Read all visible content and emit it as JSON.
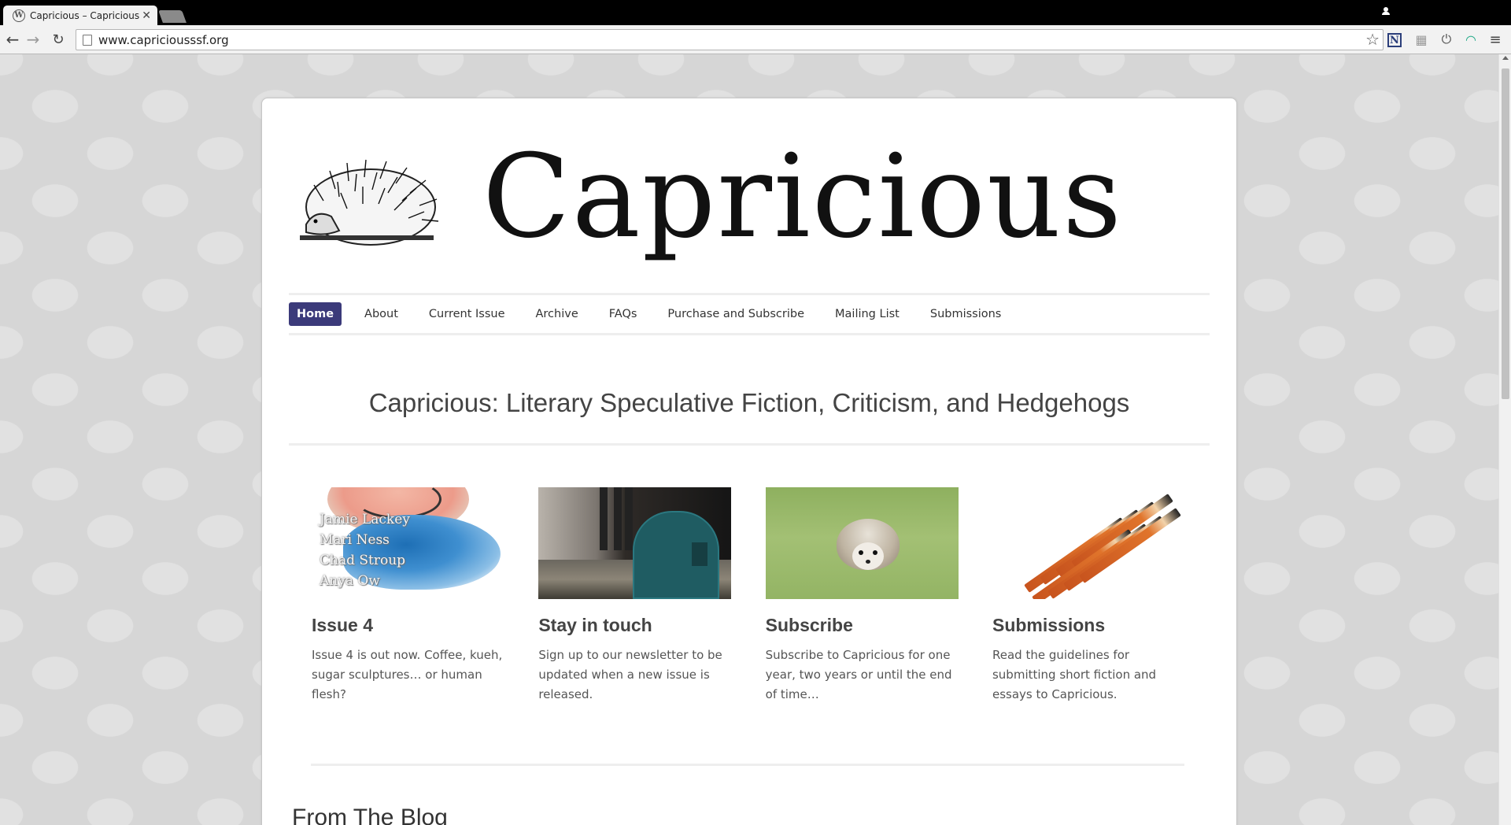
{
  "browser": {
    "tab_title": "Capricious – Capricious",
    "favicon": "wordpress-icon",
    "url": "www.capriciousssf.org",
    "extension_icons": [
      "n-icon",
      "grid-icon",
      "power-icon",
      "arc-icon",
      "menu-icon"
    ]
  },
  "site": {
    "title": "Capricious",
    "logo": "hedgehog-engraving",
    "accent_color": "#3b3a7a"
  },
  "nav": {
    "items": [
      {
        "label": "Home",
        "active": true
      },
      {
        "label": "About"
      },
      {
        "label": "Current Issue"
      },
      {
        "label": "Archive"
      },
      {
        "label": "FAQs"
      },
      {
        "label": "Purchase and Subscribe"
      },
      {
        "label": "Mailing List"
      },
      {
        "label": "Submissions"
      }
    ]
  },
  "tagline": "Capricious: Literary Speculative Fiction, Criticism, and Hedgehogs",
  "features": [
    {
      "title": "Issue 4",
      "text": "Issue 4 is out now. Coffee, kueh, sugar sculptures… or human flesh?",
      "image_names": [
        "Jamie Lackey",
        "Mari Ness",
        "Chad Stroup",
        "Anya Ow"
      ]
    },
    {
      "title": "Stay in touch",
      "text": "Sign up to our newsletter to be updated when a new issue is released."
    },
    {
      "title": "Subscribe",
      "text": "Subscribe to Capricious for one year, two years or until the end of time…"
    },
    {
      "title": "Submissions",
      "text": "Read the guidelines for submitting short fiction and essays to Capricious."
    }
  ],
  "blog": {
    "heading": "From The Blog"
  }
}
